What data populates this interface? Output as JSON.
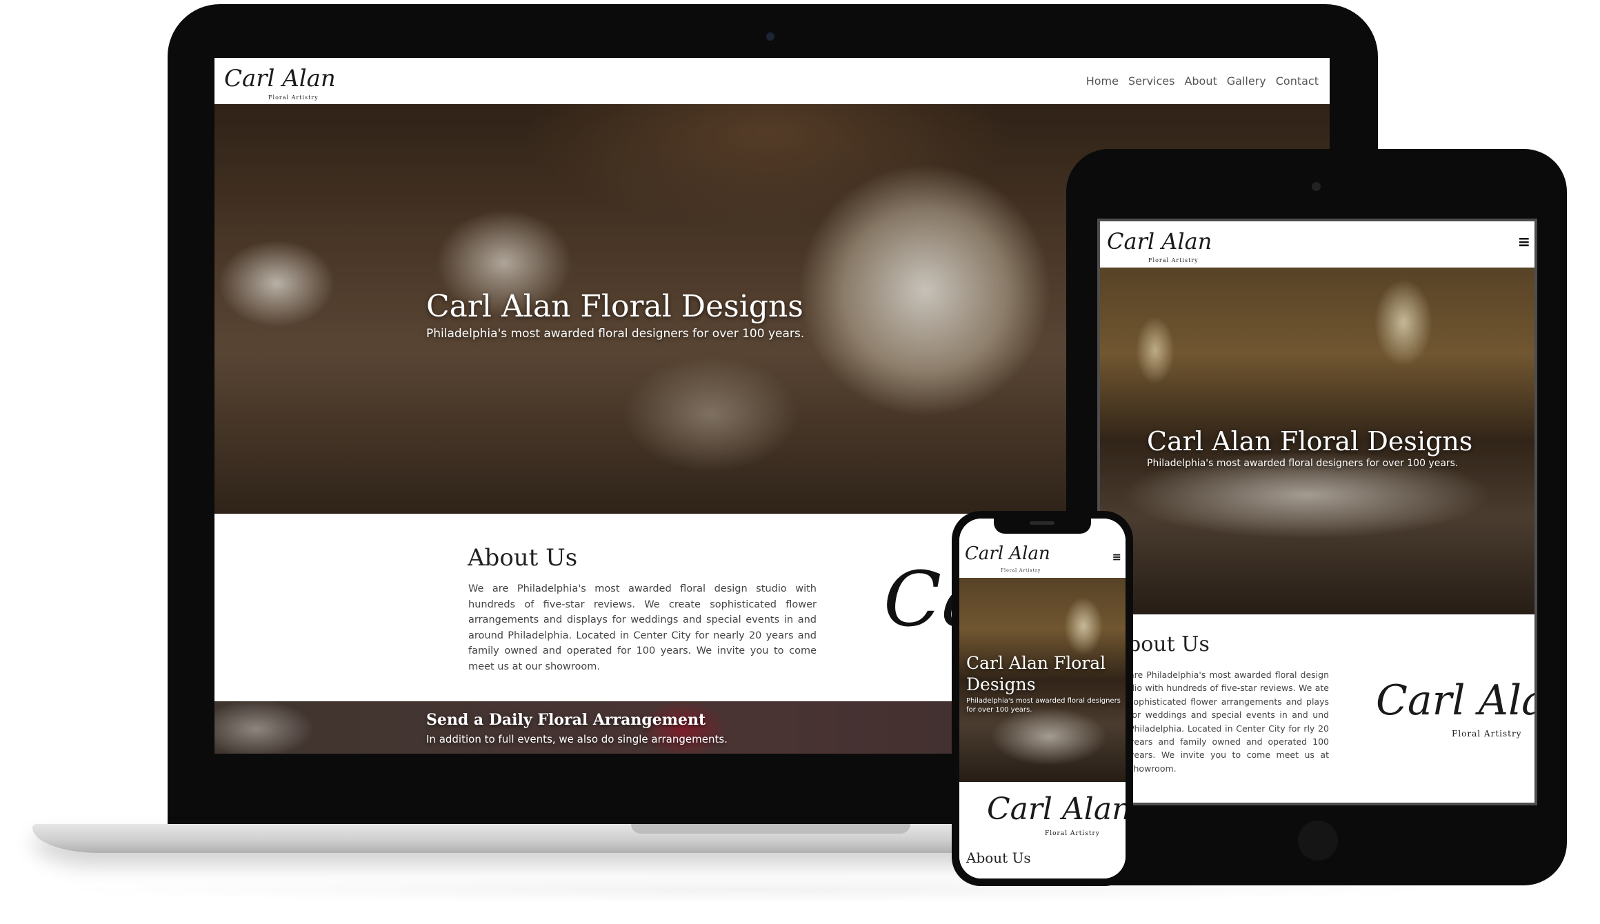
{
  "site": {
    "logo_main": "Carl Alan",
    "logo_sub": "Floral Artistry",
    "nav": [
      "Home",
      "Services",
      "About",
      "Gallery",
      "Contact"
    ],
    "hero_title": "Carl Alan Floral Designs",
    "hero_sub": "Philadelphia's most awarded floral designers for over 100 years.",
    "about_title": "About Us",
    "about_text": "We are Philadelphia's most awarded floral design studio with hundreds of five-star reviews. We create sophisticated flower arrangements and displays for weddings and special events in and around Philadelphia. Located in Center City for nearly 20 years and family owned and operated for 100 years. We invite you to come meet us at our showroom.",
    "about_partial_title": "bout Us",
    "about_partial_text": "are Philadelphia's most awarded floral design dio with hundreds of five-star reviews. We ate sophisticated flower arrangements and plays for weddings and special events in and und Philadelphia. Located in Center City for rly 20 years and family owned and operated 100 years. We invite you to come meet us at showroom.",
    "daily_title": "Send a Daily Floral Arrangement",
    "daily_sub": "In addition to full events, we also do single arrangements.",
    "menu_icon": "≡",
    "signature_fragment": "Car"
  },
  "phone": {
    "hero_title_1": "Carl Alan Floral",
    "hero_title_2": "Designs"
  },
  "colors": {
    "device_black": "#0b0b0b",
    "nav_text": "#555555",
    "hero_text": "#ffffff"
  }
}
